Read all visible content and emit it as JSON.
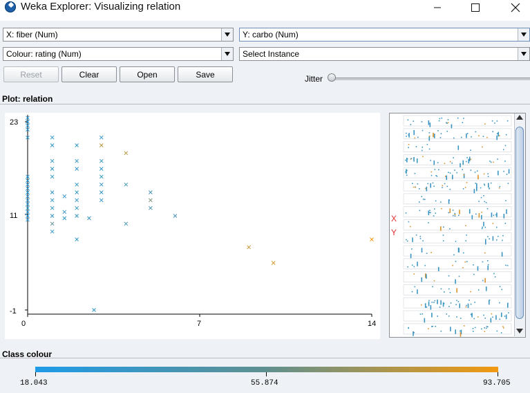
{
  "window": {
    "title": "Weka Explorer: Visualizing relation",
    "controls": {
      "minimize": "—",
      "maximize": "☐",
      "close": "✕"
    }
  },
  "controls": {
    "x_axis": "X: fiber (Num)",
    "y_axis": "Y: carbo (Num)",
    "colour": "Colour: rating (Num)",
    "select_instance": "Select Instance",
    "reset": "Reset",
    "clear": "Clear",
    "open": "Open",
    "save": "Save",
    "jitter_label": "Jitter",
    "jitter_value": 0
  },
  "plot": {
    "label": "Plot: relation",
    "y_ticks": [
      "23",
      "11",
      "-1"
    ],
    "x_ticks": [
      "0",
      "7",
      "14"
    ],
    "x_label_marker": "X",
    "y_label_marker": "Y"
  },
  "class_colour": {
    "label": "Class colour",
    "min": "18.043",
    "mid": "55.874",
    "max": "93.705",
    "colors": {
      "low": "#1e9be8",
      "mid": "#5f9090",
      "high": "#f2990f"
    }
  },
  "chart_data": {
    "type": "scatter",
    "xlabel": "fiber",
    "ylabel": "carbo",
    "xlim": [
      0,
      14
    ],
    "ylim": [
      -1,
      23
    ],
    "points": [
      {
        "x": 0,
        "y": 23.5,
        "c": 0.05
      },
      {
        "x": 0,
        "y": 23,
        "c": 0.05
      },
      {
        "x": 0,
        "y": 22.5,
        "c": 0.05
      },
      {
        "x": 0,
        "y": 22,
        "c": 0.05
      },
      {
        "x": 0,
        "y": 21,
        "c": 0.05
      },
      {
        "x": 0,
        "y": 16,
        "c": 0.05
      },
      {
        "x": 0,
        "y": 15.5,
        "c": 0.1
      },
      {
        "x": 0,
        "y": 15,
        "c": 0.05
      },
      {
        "x": 0,
        "y": 14.5,
        "c": 0.05
      },
      {
        "x": 0,
        "y": 14,
        "c": 0.05
      },
      {
        "x": 0,
        "y": 13.5,
        "c": 0.1
      },
      {
        "x": 0,
        "y": 13,
        "c": 0.05
      },
      {
        "x": 0,
        "y": 12.5,
        "c": 0.05
      },
      {
        "x": 0,
        "y": 12,
        "c": 0.05
      },
      {
        "x": 0,
        "y": 11.5,
        "c": 0.05
      },
      {
        "x": 0,
        "y": 11,
        "c": 0.05
      },
      {
        "x": 0,
        "y": 10.5,
        "c": 0.1
      },
      {
        "x": 1,
        "y": 21,
        "c": 0.15
      },
      {
        "x": 1,
        "y": 20,
        "c": 0.2
      },
      {
        "x": 1,
        "y": 18,
        "c": 0.2
      },
      {
        "x": 1,
        "y": 17,
        "c": 0.2
      },
      {
        "x": 1,
        "y": 16,
        "c": 0.2
      },
      {
        "x": 1,
        "y": 14,
        "c": 0.2
      },
      {
        "x": 1,
        "y": 13,
        "c": 0.2
      },
      {
        "x": 1,
        "y": 12,
        "c": 0.2
      },
      {
        "x": 1,
        "y": 11,
        "c": 0.2
      },
      {
        "x": 1,
        "y": 10,
        "c": 0.5
      },
      {
        "x": 1,
        "y": 9,
        "c": 0.2
      },
      {
        "x": 1.5,
        "y": 13.5,
        "c": 0.2
      },
      {
        "x": 1.5,
        "y": 11.5,
        "c": 0.2
      },
      {
        "x": 1.5,
        "y": 10.7,
        "c": 0.2
      },
      {
        "x": 2,
        "y": 20,
        "c": 0.2
      },
      {
        "x": 2,
        "y": 18,
        "c": 0.2
      },
      {
        "x": 2,
        "y": 17,
        "c": 0.2
      },
      {
        "x": 2,
        "y": 15,
        "c": 0.2
      },
      {
        "x": 2,
        "y": 14,
        "c": 0.2
      },
      {
        "x": 2,
        "y": 13,
        "c": 0.2
      },
      {
        "x": 2,
        "y": 12,
        "c": 0.2
      },
      {
        "x": 2,
        "y": 11,
        "c": 0.2
      },
      {
        "x": 2,
        "y": 8,
        "c": 0.2
      },
      {
        "x": 2.5,
        "y": 10.7,
        "c": 0.2
      },
      {
        "x": 2.7,
        "y": -1,
        "c": 0.15
      },
      {
        "x": 3,
        "y": 21,
        "c": 0.2
      },
      {
        "x": 3,
        "y": 20,
        "c": 0.8
      },
      {
        "x": 3,
        "y": 18,
        "c": 0.2
      },
      {
        "x": 3,
        "y": 17,
        "c": 0.2
      },
      {
        "x": 3,
        "y": 16,
        "c": 0.2
      },
      {
        "x": 3,
        "y": 15,
        "c": 0.2
      },
      {
        "x": 3,
        "y": 14,
        "c": 0.2
      },
      {
        "x": 3,
        "y": 13,
        "c": 0.2
      },
      {
        "x": 4,
        "y": 19,
        "c": 0.8
      },
      {
        "x": 4,
        "y": 15,
        "c": 0.3
      },
      {
        "x": 4,
        "y": 10,
        "c": 0.3
      },
      {
        "x": 5,
        "y": 14,
        "c": 0.3
      },
      {
        "x": 5,
        "y": 13,
        "c": 0.6
      },
      {
        "x": 5,
        "y": 12,
        "c": 0.3
      },
      {
        "x": 6,
        "y": 11,
        "c": 0.3
      },
      {
        "x": 9,
        "y": 7,
        "c": 0.85
      },
      {
        "x": 10,
        "y": 5,
        "c": 0.9
      },
      {
        "x": 14,
        "y": 8,
        "c": 1.0
      }
    ]
  }
}
